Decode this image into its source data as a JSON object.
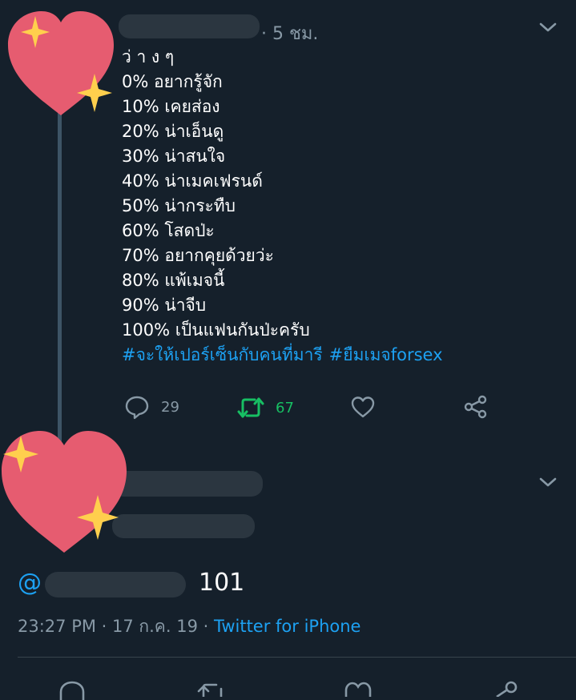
{
  "tweet": {
    "time_ago": "· 5 ชม.",
    "lines": [
      "ว่ า ง ๆ",
      "0% อยากรู้จัก",
      "10% เคยส่อง",
      "20% น่าเอ็นดู",
      "30% น่าสนใจ",
      "40% น่าเมคเฟรนด์",
      "50% น่ากระทืบ",
      "60% โสดป่ะ",
      "70% อยากคุยด้วยว่ะ",
      "80%  แพ้เมจนี้",
      "90% น่าจีบ",
      "100% เป็นแฟนกันป่ะครับ"
    ],
    "hashtags": [
      "#จะให้เปอร์เซ็นกับคนที่มารี",
      "#ยืมเมจforsex"
    ],
    "actions": {
      "reply_count": "29",
      "retweet_count": "67"
    },
    "colors": {
      "retweet_active": "#17bf63",
      "link": "#1da1f2"
    }
  },
  "reply": {
    "at": "@",
    "text": "101",
    "time": "23:27 PM",
    "date": "· 17 ก.ค. 19 ·",
    "source": "Twitter for iPhone"
  },
  "icons": {
    "reply": "speech-bubble-icon",
    "retweet": "retweet-arrows-icon",
    "like": "heart-outline-icon",
    "share": "share-nodes-icon",
    "more": "chevron-down-icon",
    "sticker": "sparkling-heart-emoji"
  }
}
